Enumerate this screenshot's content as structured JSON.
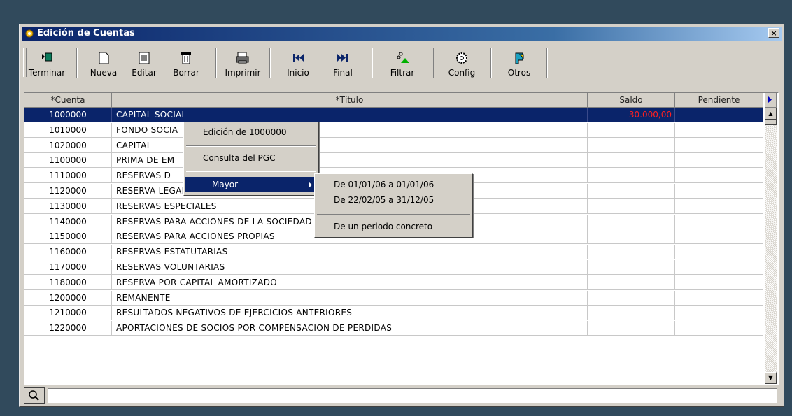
{
  "window": {
    "title": "Edición de Cuentas",
    "close_label": "×"
  },
  "toolbar": {
    "buttons": [
      {
        "label": "Terminar",
        "icon": "exit-icon"
      },
      {
        "label": "Nueva",
        "icon": "new-document-icon"
      },
      {
        "label": "Editar",
        "icon": "edit-icon"
      },
      {
        "label": "Borrar",
        "icon": "trash-icon"
      },
      {
        "label": "Imprimir",
        "icon": "printer-icon"
      },
      {
        "label": "Inicio",
        "icon": "first-icon"
      },
      {
        "label": "Final",
        "icon": "last-icon"
      },
      {
        "label": "Filtrar",
        "icon": "filter-icon"
      },
      {
        "label": "Config",
        "icon": "gear-icon"
      },
      {
        "label": "Otros",
        "icon": "others-icon"
      }
    ]
  },
  "grid": {
    "headers": {
      "cuenta": "*Cuenta",
      "titulo": "*Título",
      "saldo": "Saldo",
      "pendiente": "Pendiente"
    },
    "rows": [
      {
        "cuenta": "1000000",
        "titulo": "CAPITAL SOCIAL",
        "saldo": "-30.000,00",
        "pendiente": ""
      },
      {
        "cuenta": "1010000",
        "titulo": "FONDO SOCIA",
        "saldo": "",
        "pendiente": ""
      },
      {
        "cuenta": "1020000",
        "titulo": "CAPITAL",
        "saldo": "",
        "pendiente": ""
      },
      {
        "cuenta": "1100000",
        "titulo": "PRIMA DE EM",
        "saldo": "",
        "pendiente": ""
      },
      {
        "cuenta": "1110000",
        "titulo": "RESERVAS D",
        "saldo": "",
        "pendiente": ""
      },
      {
        "cuenta": "1120000",
        "titulo": "RESERVA LEGAL",
        "saldo": "",
        "pendiente": ""
      },
      {
        "cuenta": "1130000",
        "titulo": "RESERVAS ESPECIALES",
        "saldo": "",
        "pendiente": ""
      },
      {
        "cuenta": "1140000",
        "titulo": "RESERVAS PARA ACCIONES DE LA SOCIEDAD DOMINANTE",
        "saldo": "",
        "pendiente": ""
      },
      {
        "cuenta": "1150000",
        "titulo": "RESERVAS PARA ACCIONES PROPIAS",
        "saldo": "",
        "pendiente": ""
      },
      {
        "cuenta": "1160000",
        "titulo": "RESERVAS ESTATUTARIAS",
        "saldo": "",
        "pendiente": ""
      },
      {
        "cuenta": "1170000",
        "titulo": "RESERVAS VOLUNTARIAS",
        "saldo": "",
        "pendiente": ""
      },
      {
        "cuenta": "1180000",
        "titulo": "RESERVA POR CAPITAL AMORTIZADO",
        "saldo": "",
        "pendiente": ""
      },
      {
        "cuenta": "1200000",
        "titulo": "REMANENTE",
        "saldo": "",
        "pendiente": ""
      },
      {
        "cuenta": "1210000",
        "titulo": "RESULTADOS NEGATIVOS DE EJERCICIOS ANTERIORES",
        "saldo": "",
        "pendiente": ""
      },
      {
        "cuenta": "1220000",
        "titulo": "APORTACIONES DE SOCIOS POR COMPENSACION DE PERDIDAS",
        "saldo": "",
        "pendiente": ""
      }
    ]
  },
  "context_menu": {
    "items": [
      "Edición de 1000000",
      "Consulta del PGC",
      "Mayor"
    ]
  },
  "submenu": {
    "items": [
      "De 01/01/06 a 01/01/06",
      "De 22/02/05 a 31/12/05",
      "De un periodo concreto"
    ]
  },
  "search": {
    "value": ""
  },
  "colors": {
    "selection": "#0a246a",
    "negative": "#ff2020",
    "desktop": "#314a5c"
  }
}
